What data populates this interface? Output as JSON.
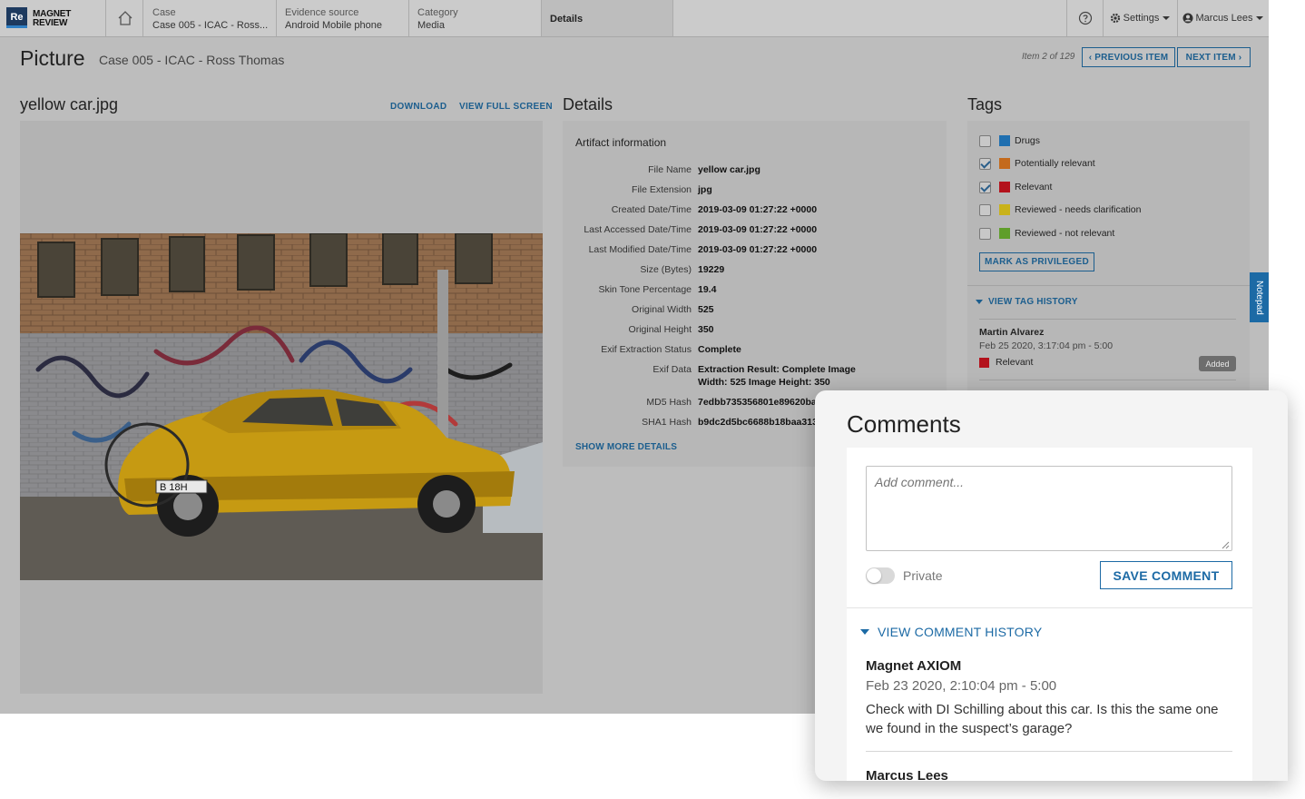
{
  "app": {
    "logo_mark": "Re",
    "logo_line1": "MAGNET",
    "logo_line2": "REVIEW"
  },
  "breadcrumbs": [
    {
      "key": "Case",
      "value": "Case 005 - ICAC - Ross..."
    },
    {
      "key": "Evidence source",
      "value": "Android Mobile phone"
    },
    {
      "key": "Category",
      "value": "Media"
    },
    {
      "key": "",
      "value": "Details"
    }
  ],
  "topbar": {
    "settings_label": "Settings",
    "user_label": "Marcus Lees"
  },
  "header": {
    "title": "Picture",
    "subtitle": "Case 005 - ICAC - Ross Thomas",
    "item_count": "Item 2 of 129",
    "prev_label": "PREVIOUS ITEM",
    "next_label": "NEXT ITEM"
  },
  "viewer": {
    "file_name": "yellow car.jpg",
    "download_label": "DOWNLOAD",
    "fullscreen_label": "VIEW FULL SCREEN"
  },
  "details": {
    "section_title": "Details",
    "card_title": "Artifact information",
    "rows": [
      {
        "label": "File Name",
        "value": "yellow car.jpg"
      },
      {
        "label": "File Extension",
        "value": "jpg"
      },
      {
        "label": "Created Date/Time",
        "value": "2019-03-09 01:27:22 +0000"
      },
      {
        "label": "Last Accessed Date/Time",
        "value": "2019-03-09 01:27:22 +0000"
      },
      {
        "label": "Last Modified Date/Time",
        "value": "2019-03-09 01:27:22 +0000"
      },
      {
        "label": "Size (Bytes)",
        "value": "19229"
      },
      {
        "label": "Skin Tone Percentage",
        "value": "19.4"
      },
      {
        "label": "Original Width",
        "value": "525"
      },
      {
        "label": "Original Height",
        "value": "350"
      },
      {
        "label": "Exif Extraction Status",
        "value": "Complete"
      },
      {
        "label": "Exif Data",
        "value": "Extraction Result: Complete Image",
        "value2": "Width: 525 Image Height: 350"
      },
      {
        "label": "MD5 Hash",
        "value": "7edbb735356801e89620ba"
      },
      {
        "label": "SHA1 Hash",
        "value": "b9dc2d5bc6688b18baa313"
      }
    ],
    "show_more_label": "SHOW MORE DETAILS"
  },
  "tags": {
    "section_title": "Tags",
    "items": [
      {
        "label": "Drugs",
        "checked": false,
        "color": "#1f6fb0"
      },
      {
        "label": "Potentially relevant",
        "checked": true,
        "color": "#c46a1c"
      },
      {
        "label": "Relevant",
        "checked": true,
        "color": "#b3121c"
      },
      {
        "label": "Reviewed - needs clarification",
        "checked": false,
        "color": "#c9b21a"
      },
      {
        "label": "Reviewed - not relevant",
        "checked": false,
        "color": "#5f9e2a"
      }
    ],
    "privileged_label": "MARK AS PRIVILEGED",
    "history_label": "VIEW TAG HISTORY",
    "history": [
      {
        "user": "Martin Alvarez",
        "date": "Feb 25 2020, 3:17:04 pm - 5:00",
        "tag": "Relevant",
        "tag_color": "#b3121c",
        "action": "Added"
      }
    ]
  },
  "notepad_label": "Notepad",
  "comments": {
    "title": "Comments",
    "placeholder": "Add comment...",
    "private_label": "Private",
    "save_label": "SAVE COMMENT",
    "history_label": "VIEW COMMENT HISTORY",
    "entries": [
      {
        "user": "Magnet AXIOM",
        "date": "Feb 23 2020, 2:10:04 pm - 5:00",
        "text": "Check with DI Schilling about this car. Is this the same one we found in the suspect’s garage?"
      },
      {
        "user": "Marcus Lees",
        "date": "",
        "text": ""
      }
    ]
  },
  "colors": {
    "accent": "#1c6aa5",
    "link": "#1c5e8e"
  }
}
